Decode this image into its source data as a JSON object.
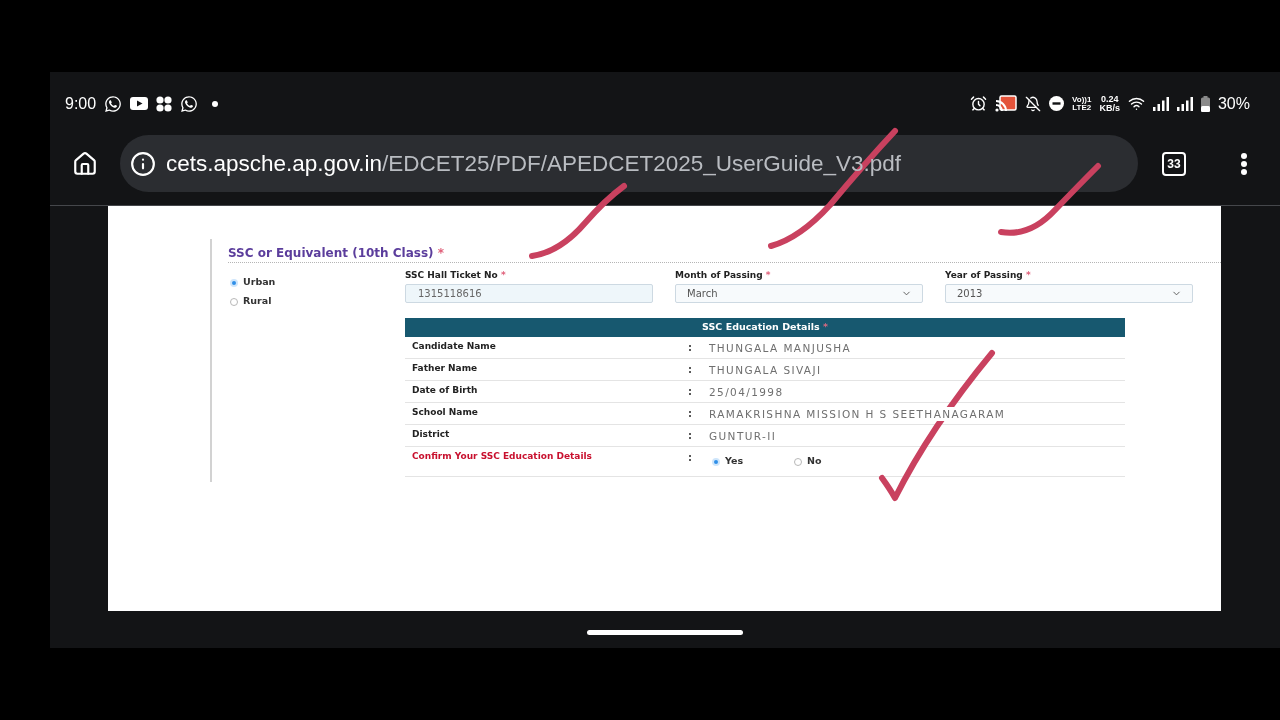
{
  "status_bar": {
    "time": "9:00",
    "volte": [
      "Vo))1",
      "LTE2"
    ],
    "speed": [
      "0.24",
      "KB/s"
    ],
    "battery": "30%"
  },
  "browser": {
    "url_host": "cets.apsche.ap.gov.in",
    "url_path": "/EDCET25/PDF/APEDCET2025_UserGuide_V3.pdf",
    "tab_count": "33"
  },
  "document": {
    "section_title": "SSC or Equivalent (10th Class)",
    "section_mark": "*",
    "area_options": [
      {
        "label": "Urban",
        "selected": true
      },
      {
        "label": "Rural",
        "selected": false
      }
    ],
    "fields": [
      {
        "kind": "text",
        "label": "SSC Hall Ticket No",
        "mark": "*",
        "value": "1315118616"
      },
      {
        "kind": "select",
        "label": "Month of Passing",
        "mark": "*",
        "value": "March"
      },
      {
        "kind": "select",
        "label": "Year of Passing",
        "mark": "*",
        "value": "2013"
      }
    ],
    "details": {
      "title": "SSC Education Details",
      "mark": "*",
      "rows": [
        {
          "label": "Candidate Name",
          "separator": ":",
          "value": "THUNGALA MANJUSHA"
        },
        {
          "label": "Father Name",
          "separator": ":",
          "value": "THUNGALA SIVAJI"
        },
        {
          "label": "Date of Birth",
          "separator": ":",
          "value": "25/04/1998"
        },
        {
          "label": "School Name",
          "separator": ":",
          "value": "RAMAKRISHNA MISSION H S SEETHANAGARAM"
        },
        {
          "label": "District",
          "separator": ":",
          "value": "GUNTUR-II"
        }
      ],
      "confirm": {
        "label": "Confirm Your SSC Education Details",
        "separator": ":",
        "options": [
          {
            "label": "Yes",
            "selected": true
          },
          {
            "label": "No",
            "selected": false
          }
        ]
      }
    }
  }
}
